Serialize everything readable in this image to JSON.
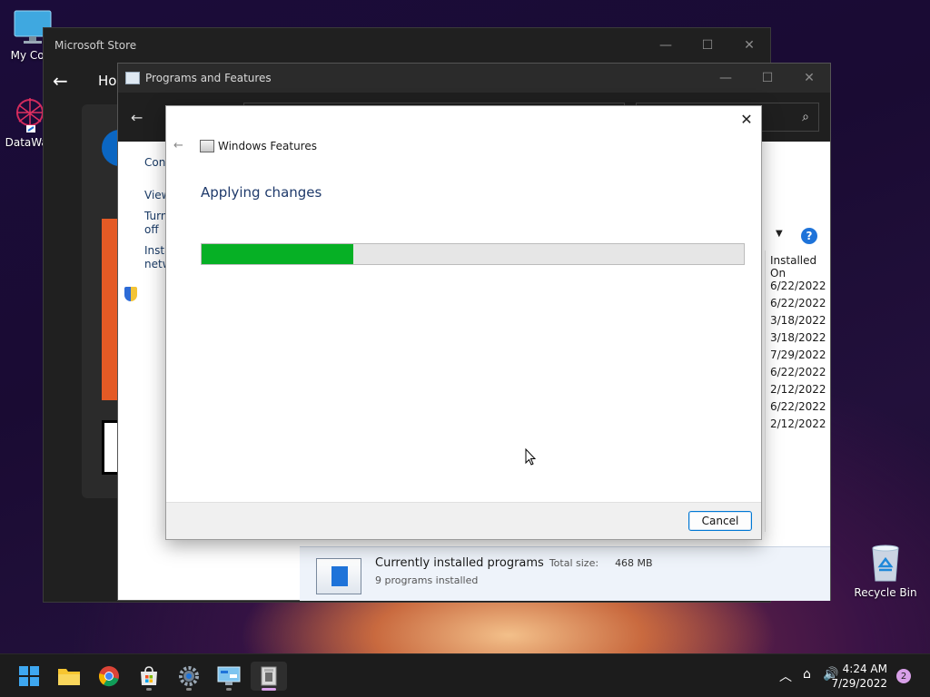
{
  "desktop": {
    "icons": [
      {
        "label": "My Com",
        "icon": "computer-icon"
      },
      {
        "label": "DataWag",
        "icon": "datawagon-icon"
      },
      {
        "label": "Recycle Bin",
        "icon": "recycle-bin-icon"
      }
    ]
  },
  "store_window": {
    "title": "Microsoft Store",
    "nav_home": "Hom",
    "controls": {
      "minimize": "—",
      "maximize": "☐",
      "close": "✕"
    }
  },
  "programs_window": {
    "title": "Programs and Features",
    "controls": {
      "minimize": "—",
      "maximize": "☐",
      "close": "✕"
    },
    "back": "←",
    "forward": "→",
    "search_icon": "⌕",
    "sidebar": {
      "link1": "Cont",
      "link2": "View",
      "link3_line1": "Turn",
      "link3_line2": "off",
      "link4_line1": "Insta",
      "link4_line2": "netw"
    },
    "dropdown_arrow": "▼",
    "help": "?",
    "column_header": "Installed On",
    "installed_dates": [
      "6/22/2022",
      "6/22/2022",
      "3/18/2022",
      "3/18/2022",
      "7/29/2022",
      "6/22/2022",
      "2/12/2022",
      "6/22/2022",
      "2/12/2022"
    ],
    "status": {
      "title": "Currently installed programs",
      "total_size_label": "Total size:",
      "total_size_value": "468 MB",
      "count": "9 programs installed"
    }
  },
  "features_dialog": {
    "title": "Windows Features",
    "heading": "Applying changes",
    "progress_fraction": 0.28,
    "cancel_label": "Cancel",
    "close": "✕",
    "back": "←",
    "accent_color": "#06b025"
  },
  "taskbar": {
    "apps": [
      {
        "name": "start-icon"
      },
      {
        "name": "file-explorer-icon"
      },
      {
        "name": "chrome-icon"
      },
      {
        "name": "store-icon"
      },
      {
        "name": "settings-icon"
      },
      {
        "name": "control-panel-icon"
      },
      {
        "name": "programs-features-icon"
      }
    ],
    "tray": {
      "chevron": "︿",
      "network": "⌂",
      "volume": "🔊",
      "time": "4:24 AM",
      "date": "7/29/2022",
      "notifications": "2"
    }
  }
}
